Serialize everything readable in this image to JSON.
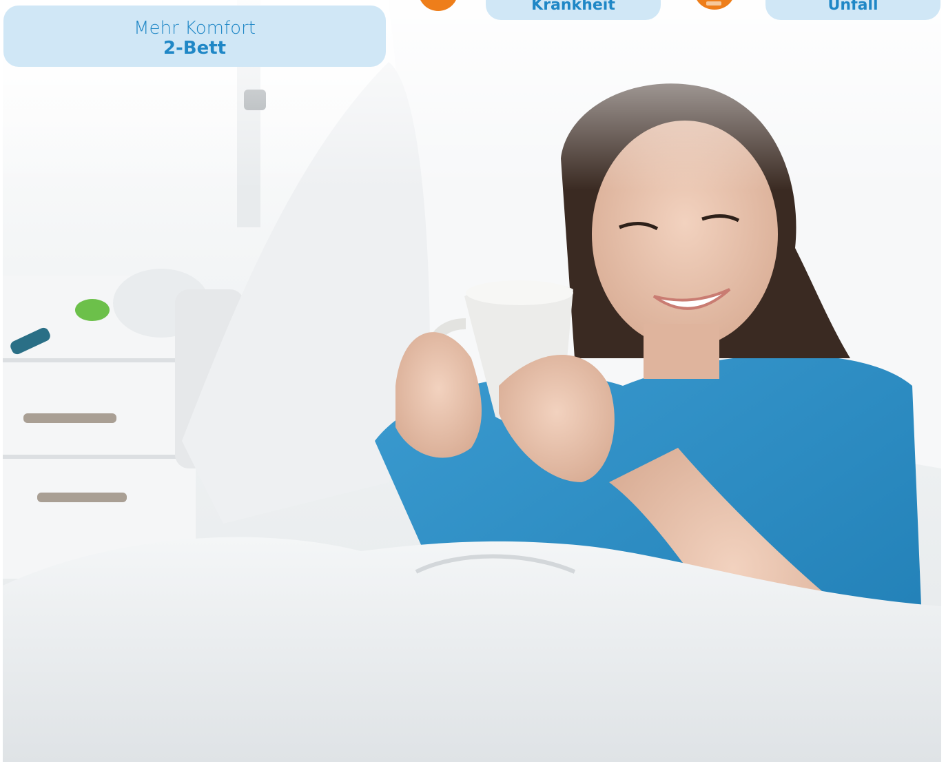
{
  "comfort_card": {
    "line1": "Mehr Komfort",
    "line2": "2-Bett"
  },
  "top_cards": {
    "krankheit": "Krankheit",
    "unfall": "Unfall"
  },
  "colors": {
    "pill_bg": "#d0e7f6",
    "pill_text": "#1f87c6",
    "accent_orange": "#ee7e1a",
    "gown_blue": "#2e8fc4"
  },
  "photo": {
    "subject": "hospital-patient-with-mug-photo"
  }
}
